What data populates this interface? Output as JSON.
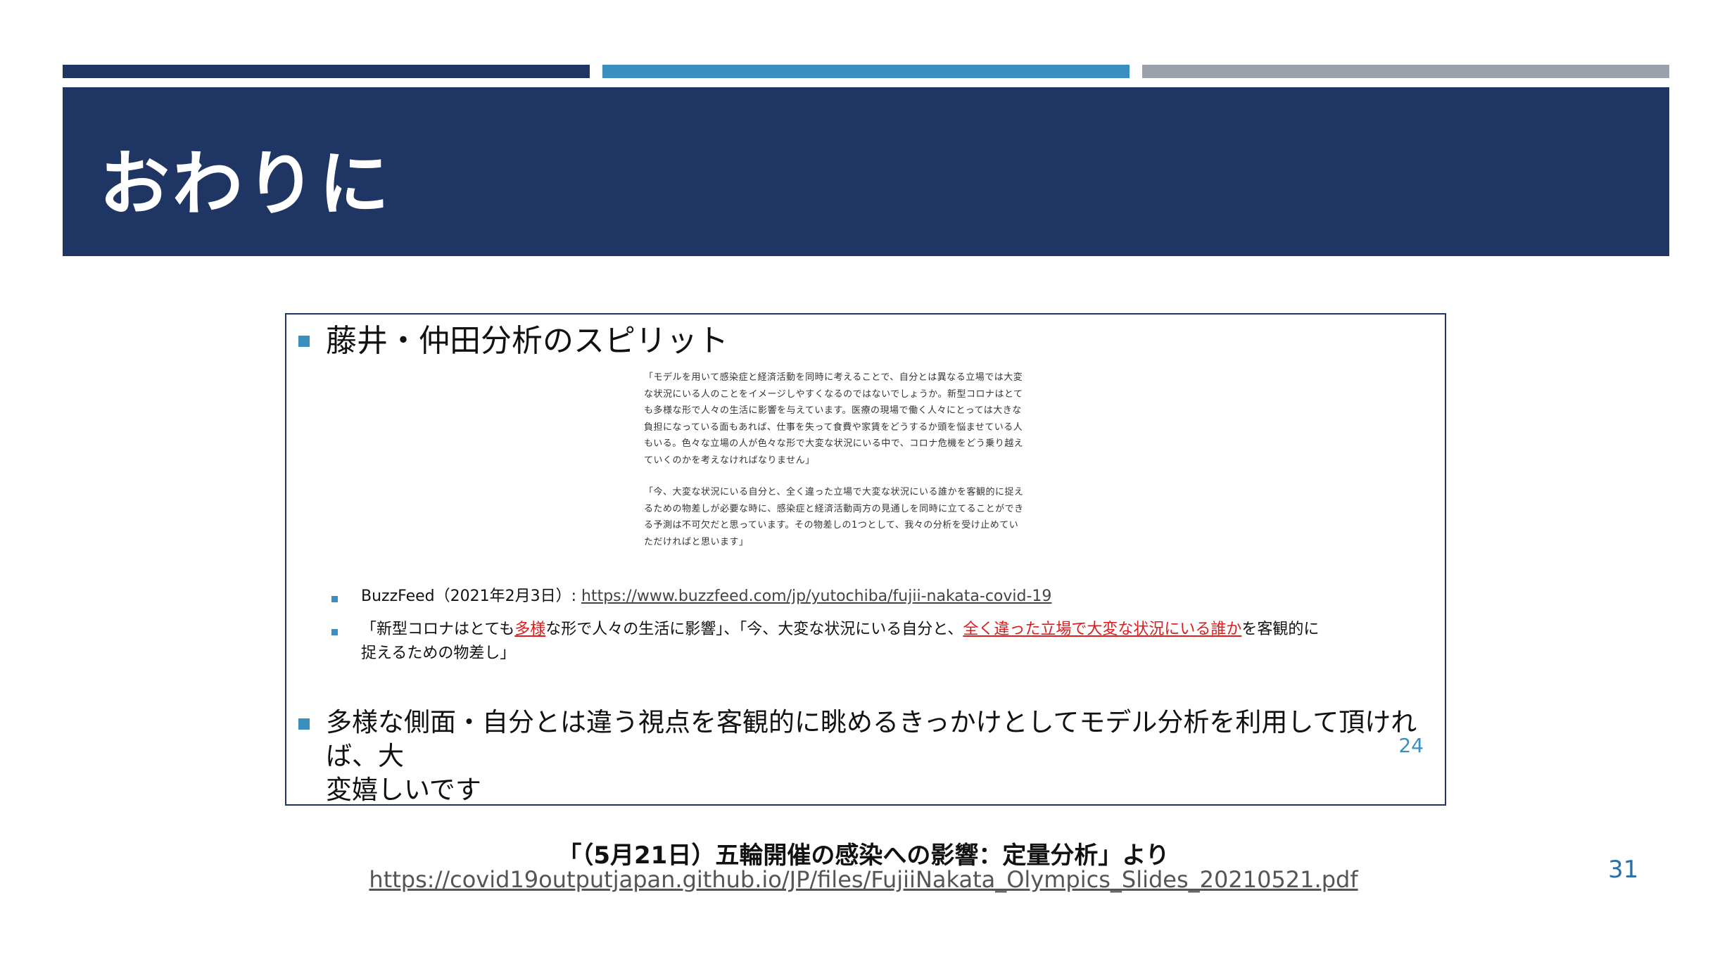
{
  "slide": {
    "title": "おわりに",
    "page_number": "31",
    "colors": {
      "primary": "#1f3564",
      "accent": "#3b8fc0",
      "gray": "#9aa1aa",
      "highlight": "#e01b1b"
    }
  },
  "inner_slide": {
    "bullet1": "藤井・仲田分析のスピリット",
    "quote1": "「モデルを用いて感染症と経済活動を同時に考えることで、自分とは異なる立場では大変な状況にいる人のことをイメージしやすくなるのではないでしょうか。新型コロナはとても多様な形で人々の生活に影響を与えています。医療の現場で働く人々にとっては大きな負担になっている面もあれば、仕事を失って食費や家賃をどうするか頭を悩ませている人もいる。色々な立場の人が色々な形で大変な状況にいる中で、コロナ危機をどう乗り越えていくのかを考えなければなりません」",
    "quote2": "「今、大変な状況にいる自分と、全く違った立場で大変な状況にいる誰かを客観的に捉えるための物差しが必要な時に、感染症と経済活動両方の見通しを同時に立てることができる予測は不可欠だと思っています。その物差しの1つとして、我々の分析を受け止めていただければと思います」",
    "sub1_prefix": "BuzzFeed（2021年2月3日）: ",
    "sub1_url": "https://www.buzzfeed.com/jp/yutochiba/fujii-nakata-covid-19",
    "sub2_a": "「新型コロナはとても",
    "sub2_red1": "多様",
    "sub2_b": "な形で人々の生活に影響」、「今、大変な状況にいる自分と、",
    "sub2_red2": "全く違った立場で大変な状況にいる誰か",
    "sub2_c": "を客観的に",
    "sub2_d": "捉えるための物差し」",
    "bullet2_line1": "多様な側面・自分とは違う視点を客観的に眺めるきっかけとしてモデル分析を利用して頂ければ、大",
    "bullet2_line2": "変嬉しいです",
    "page_number": "24"
  },
  "caption": {
    "text": "「（5月21日）五輪開催の感染への影響：定量分析」より",
    "url": "https://covid19outputjapan.github.io/JP/files/FujiiNakata_Olympics_Slides_20210521.pdf"
  }
}
